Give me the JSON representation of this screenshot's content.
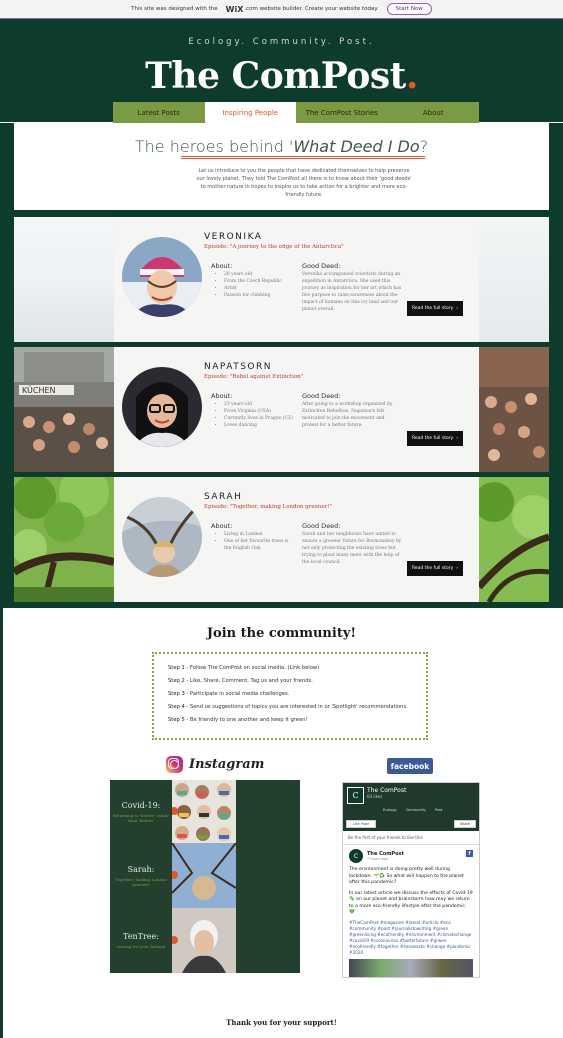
{
  "wix_banner": {
    "text_pre": "This site was designed with the",
    "brand": "WiX",
    "text_post": ".com website builder. Create your website today.",
    "cta": "Start Now"
  },
  "header": {
    "tagline": "Ecology. Community. Post.",
    "logo": "The ComPost",
    "logo_dot": "."
  },
  "nav": {
    "items": [
      "Latest Posts",
      "Inspiring People",
      "The ComPost Stories",
      "About"
    ],
    "active": "Inspiring People"
  },
  "intro": {
    "title_pre": "The heroes behind '",
    "title_em": "What Deed I Do",
    "title_post": "?",
    "text": "Let us introduce to you the people that have dedicated themselves to help preserve our lovely planet. They told The ComPost all there is to know about their 'good deeds' to mother nature in hopes to inspire us to take action for a brighter and more eco-friendly future."
  },
  "heroes": [
    {
      "name": "VERONIKA",
      "episode": "Episode: \"A journey to the edge of the Antarctica\"",
      "about_title": "About:",
      "about": [
        "28 years old",
        "From the Czech Republic",
        "Artist",
        "Passion for climbing"
      ],
      "deed_title": "Good Deed:",
      "deed": "Veronika accompanied scientists during an expedition in Antarctica. She used this journey as inspiration for her art which has five purpose to raise awareness about the impact of humans on this icy land and our planet overall.",
      "button": "Read the full story"
    },
    {
      "name": "NAPATSORN",
      "episode": "Episode: \"Rebel against Extinction\"",
      "about_title": "About:",
      "about": [
        "23 years old",
        "From Virginia (USA)",
        "Currently lives in Prague (CZ)",
        "Loves dancing"
      ],
      "deed_title": "Good Deed:",
      "deed": "After going to a workshop organized by Extinction Rebellion, Napatsorn felt motivated to join the movement and protest for a better future.",
      "button": "Read the full story"
    },
    {
      "name": "SARAH",
      "episode": "Episode: \"Together, making London greener!\"",
      "about_title": "About:",
      "about": [
        "Living in London",
        "One of her favourite trees is the English Oak"
      ],
      "deed_title": "Good Deed:",
      "deed": "Sarah and her neighbours have united to ensure a greener future for Bermondsey by not only protecting the existing trees but trying to plant many more with the help of the local council.",
      "button": "Read the full story"
    }
  ],
  "community": {
    "title": "Join the community!",
    "steps": [
      {
        "label": "Step 1",
        "text": " - Follow The ComPost on social media. (Link below)"
      },
      {
        "label": "Step 2",
        "text": " - Like, Share, Comment, Tag us and your friends."
      },
      {
        "label": "Step 3",
        "text": " - Participate in social media challenges."
      },
      {
        "label": "Step 4",
        "text": " - Send us suggestions of topics you are interested in or 'Spotlight' recommendations."
      },
      {
        "label": "Step 5",
        "text": " - Be friendly to one another and keep it green!"
      }
    ],
    "thanks": "Thank you for your support!"
  },
  "instagram": {
    "wordmark": "Instagram",
    "tiles": [
      {
        "big": "Covid-19:",
        "small": "Returning to 'before' rather than 'before'"
      },
      {
        "big": "Sarah:",
        "small": "Together, making London greener!"
      },
      {
        "big": "TenTree:",
        "small": "rooting for your fashion"
      }
    ]
  },
  "facebook": {
    "wordmark": "facebook",
    "page_name": "The ComPost",
    "likes": "64 likes",
    "menu": [
      "Ecology",
      "Community",
      "Post"
    ],
    "like_btn": "Like Page",
    "share_btn": "Share",
    "first_friends": "Be the first of your friends to like this",
    "post_name": "The ComPost",
    "post_time": "7 hours ago",
    "post_text1": "The environment is doing pretty well during lockdown. 🌱♻️ So what will happen to the planet after this pandemic?",
    "post_text2": "In our latest article we discuss the effects of Covid-19 🦠 on our planet and brainstorm how may we return to a more eco-friendly lifestyle after the pandemic. 💚",
    "post_tags": "#TheComPost #magazine #latest #article #eco #community #post #journalistowriting #green #greenliving #ecofriendly #environment #climatechange #covid19 #coronavirus #betterfuture #grwen #ecofriendly #together #zerowaste #change #pandemic #2020"
  },
  "colors": {
    "brand_green": "#0d3b2c",
    "nav_green": "#7b9a44",
    "accent_orange": "#e8542a",
    "episode_red": "#c0392b",
    "facebook_blue": "#3b5998"
  }
}
